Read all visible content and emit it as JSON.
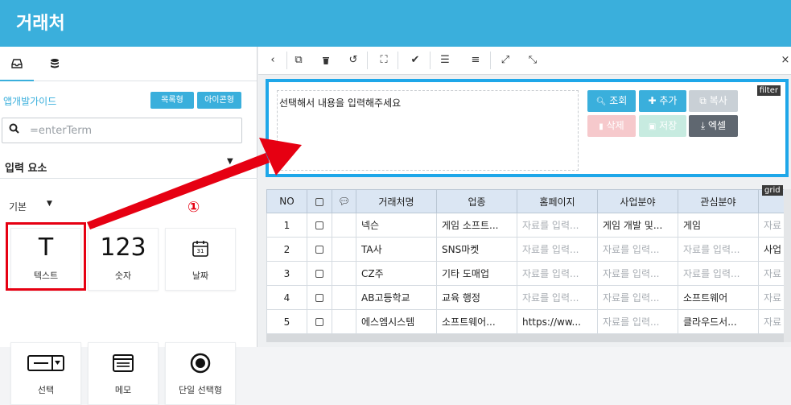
{
  "header": {
    "title": "거래처"
  },
  "left": {
    "tabs": [
      {
        "icon": "inbox-icon"
      },
      {
        "icon": "database-icon"
      }
    ],
    "guide_link": "앱개발가이드",
    "view_buttons": [
      "목록형",
      "아이콘형"
    ],
    "search": {
      "placeholder": "=enterTerm"
    },
    "section_title": "입력 요소",
    "subsection": "기본",
    "marker": "①",
    "tiles": [
      {
        "icon": "T",
        "label": "텍스트"
      },
      {
        "icon": "123",
        "label": "숫자"
      },
      {
        "icon": "calendar-icon",
        "day": "31",
        "label": "날짜"
      },
      {
        "icon": "select-icon",
        "label": "선택"
      },
      {
        "icon": "memo-icon",
        "label": "메모"
      },
      {
        "icon": "radio-icon",
        "label": "단일 선택형"
      }
    ]
  },
  "filter": {
    "tag": "filter",
    "text": "선택해서 내용을 입력해주세요",
    "buttons": [
      {
        "label": "조회",
        "color": "#3aafdc"
      },
      {
        "label": "추가",
        "color": "#3aafdc"
      },
      {
        "label": "복사",
        "color": "#c9d0d6"
      },
      {
        "label": "삭제",
        "color": "#f6c9cc"
      },
      {
        "label": "저장",
        "color": "#c7ebe0"
      },
      {
        "label": "엑셀",
        "color": "#5f6770"
      }
    ]
  },
  "grid": {
    "tag": "grid",
    "columns": [
      "NO",
      "",
      "",
      "거래처명",
      "업종",
      "홈페이지",
      "사업분야",
      "관심분야",
      ""
    ],
    "rows": [
      {
        "no": "1",
        "name": "넥슨",
        "industry": "게임 소프트...",
        "homepage": "자료를 입력...",
        "biz": "게임 개발 및...",
        "interest": "게임",
        "extra": "자료"
      },
      {
        "no": "2",
        "name": "TA사",
        "industry": "SNS마켓",
        "homepage": "자료를 입력...",
        "biz": "자료를 입력...",
        "interest": "자료를 입력...",
        "extra": "사업"
      },
      {
        "no": "3",
        "name": "CZ주",
        "industry": "기타 도매업",
        "homepage": "자료를 입력...",
        "biz": "자료를 입력...",
        "interest": "자료를 입력...",
        "extra": "자료"
      },
      {
        "no": "4",
        "name": "AB고등학교",
        "industry": "교육 행정",
        "homepage": "자료를 입력...",
        "biz": "자료를 입력...",
        "interest": "소프트웨어",
        "extra": "자료"
      },
      {
        "no": "5",
        "name": "에스엠시스템",
        "industry": "소프트웨어...",
        "homepage": "https://ww...",
        "biz": "자료를 입력...",
        "interest": "클라우드서...",
        "extra": "자료"
      }
    ]
  },
  "colors": {
    "header": "#3aafdc",
    "filter_border": "#1ea7e9",
    "annotation": "#e60012",
    "grid_header": "#dbe6f3"
  }
}
